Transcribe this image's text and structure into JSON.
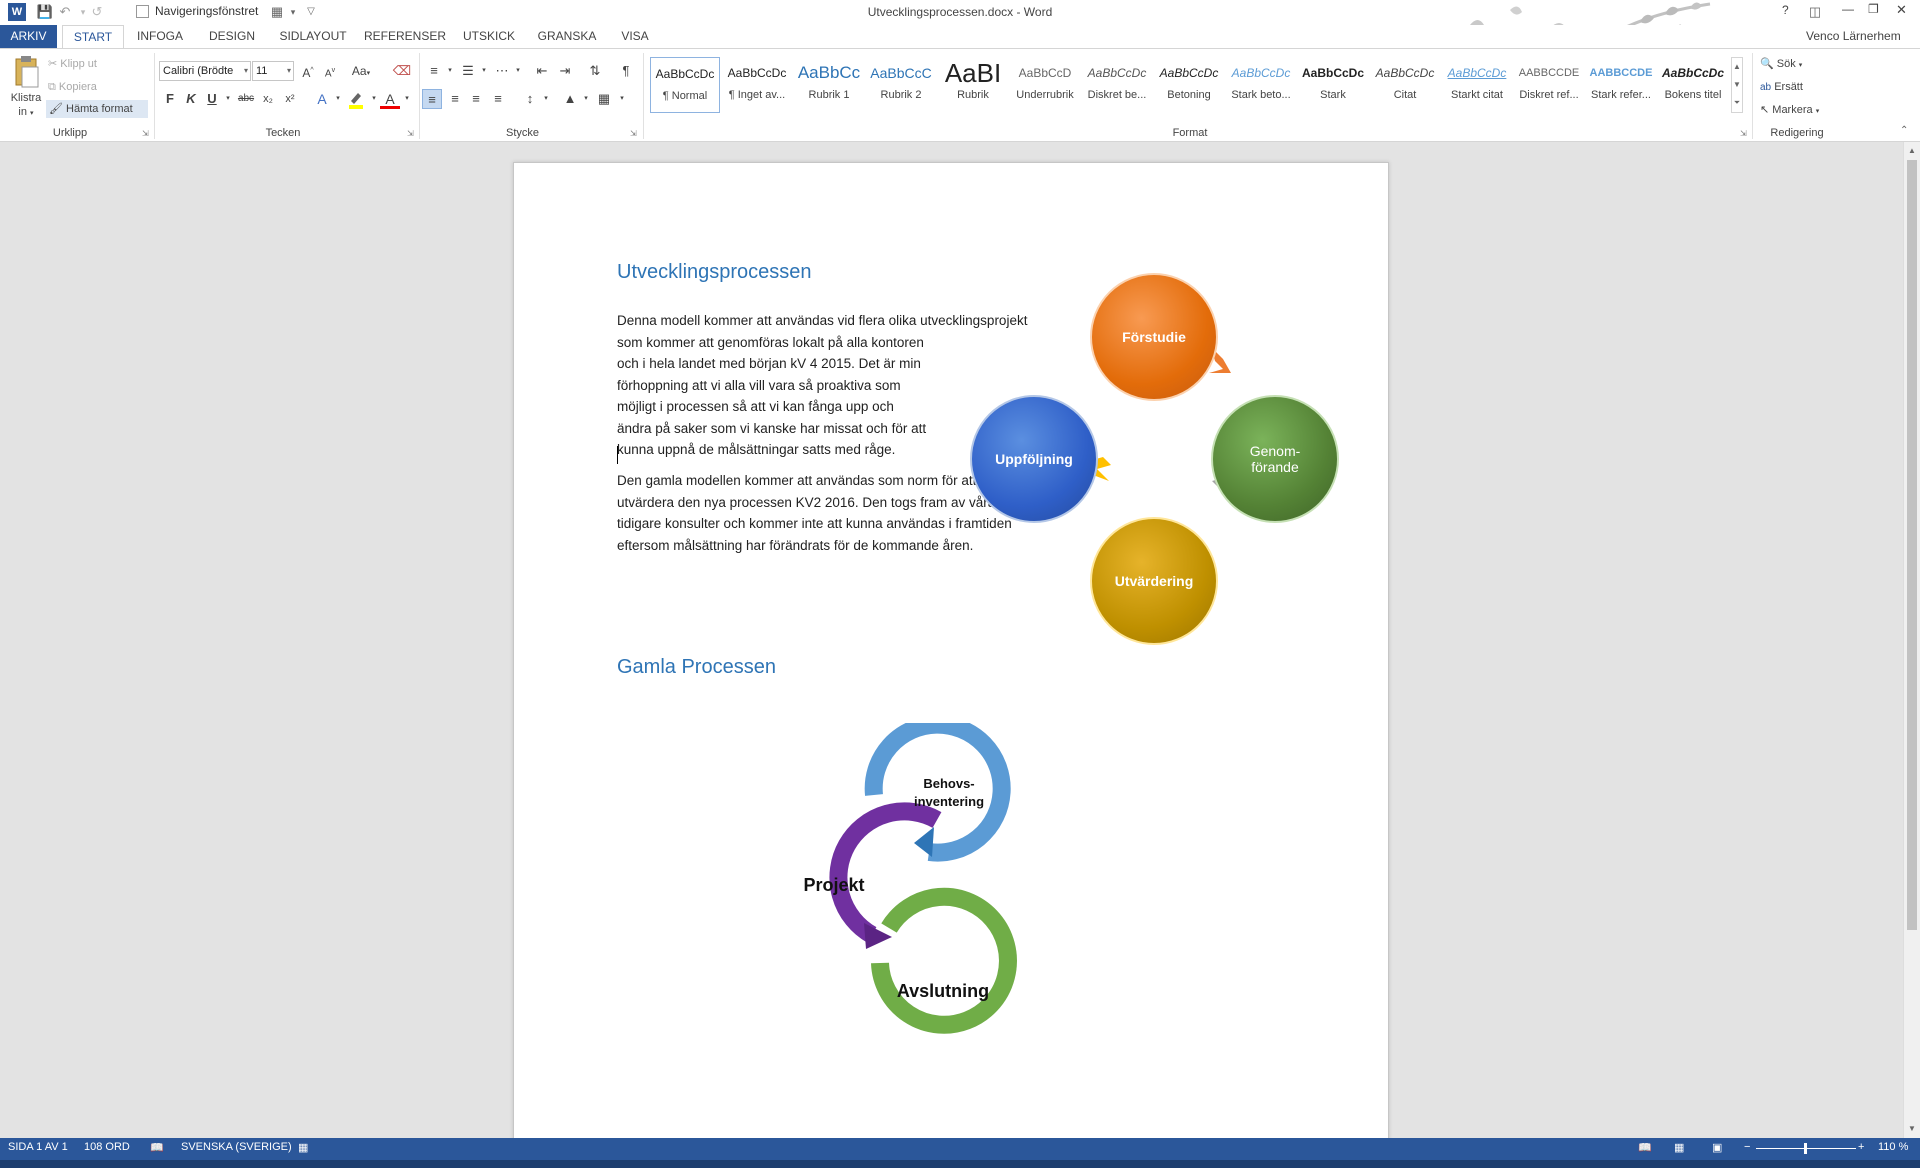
{
  "window": {
    "title": "Utvecklingsprocessen.docx - Word",
    "user": "Venco Lärnerhem",
    "nav_pane_label": "Navigeringsfönstret",
    "help": "?",
    "minimize": "—",
    "maximize": "❐",
    "close": "✕"
  },
  "tabs": [
    "ARKIV",
    "START",
    "INFOGA",
    "DESIGN",
    "SIDLAYOUT",
    "REFERENSER",
    "UTSKICK",
    "GRANSKA",
    "VISA"
  ],
  "clipboard": {
    "group_label": "Urklipp",
    "paste_label_1": "Klistra",
    "paste_label_2": "in",
    "cut_label": "Klipp ut",
    "copy_label": "Kopiera",
    "format_painter_label": "Hämta format"
  },
  "font": {
    "group_label": "Tecken",
    "font_name": "Calibri (Brödte",
    "font_size": "11",
    "bold": "F",
    "italic": "K",
    "underline": "U",
    "strike": "abc",
    "subscript": "x₂",
    "superscript": "x²",
    "change_case": "Aa",
    "text_effect": "A",
    "font_color": "A"
  },
  "paragraph": {
    "group_label": "Stycke"
  },
  "styles": {
    "group_label": "Format",
    "items": [
      {
        "sample": "AaBbCcDc",
        "name": "¶ Normal"
      },
      {
        "sample": "AaBbCcDc",
        "name": "¶ Inget av..."
      },
      {
        "sample": "AaBbCc",
        "name": "Rubrik 1"
      },
      {
        "sample": "AaBbCcC",
        "name": "Rubrik 2"
      },
      {
        "sample": "AaBI",
        "name": "Rubrik"
      },
      {
        "sample": "AaBbCcD",
        "name": "Underrubrik"
      },
      {
        "sample": "AaBbCcDc",
        "name": "Diskret be..."
      },
      {
        "sample": "AaBbCcDc",
        "name": "Betoning"
      },
      {
        "sample": "AaBbCcDc",
        "name": "Stark beto..."
      },
      {
        "sample": "AaBbCcDc",
        "name": "Stark"
      },
      {
        "sample": "AaBbCcDc",
        "name": "Citat"
      },
      {
        "sample": "AaBbCcDc",
        "name": "Starkt citat"
      },
      {
        "sample": "AABBCCDE",
        "name": "Diskret ref..."
      },
      {
        "sample": "AABBCCDE",
        "name": "Stark refer..."
      },
      {
        "sample": "AaBbCcDc",
        "name": "Bokens titel"
      }
    ]
  },
  "editing": {
    "group_label": "Redigering",
    "find_label": "Sök",
    "replace_label": "Ersätt",
    "select_label": "Markera"
  },
  "document": {
    "heading1": "Utvecklingsprocessen",
    "para1": "Denna modell kommer att användas vid flera olika utvecklingsprojekt\nsom kommer att genomföras lokalt på alla kontoren\noch i hela landet med början kV 4 2015. Det är min\nförhoppning att vi alla vill vara så proaktiva som\nmöjligt i processen så att vi kan fånga upp och\nändra på saker som vi kanske har missat och för att\nkunna uppnå de målsättningar satts med råge.",
    "para2": "Den gamla modellen kommer att användas som norm för att\nutvärdera den nya processen KV2 2016. Den togs fram av våra\ntidigare konsulter och kommer inte att kunna användas i framtiden\neftersom målsättning har förändrats för de kommande åren.",
    "heading2": "Gamla Processen",
    "cycle": {
      "forstudie": "Förstudie",
      "genomforande": "Genom-\nförande",
      "utvardering": "Utvärdering",
      "uppfoljning": "Uppföljning"
    },
    "old_process": {
      "behov": "Behovs-\ninventering",
      "projekt": "Projekt",
      "avslutning": "Avslutning"
    }
  },
  "status": {
    "page": "SIDA 1 AV 1",
    "words": "108 ORD",
    "language": "SVENSKA (SVERIGE)",
    "zoom": "110 %",
    "zoom_minus": "−",
    "zoom_plus": "+"
  }
}
